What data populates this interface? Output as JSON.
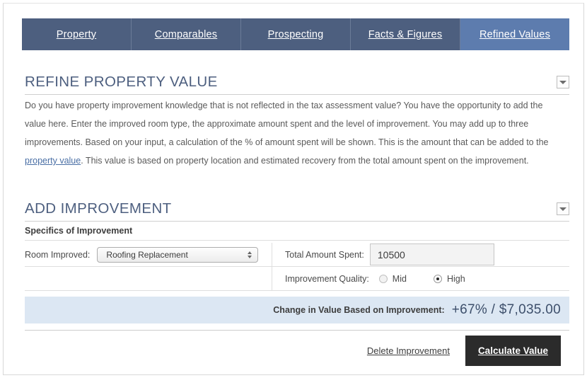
{
  "tabs": [
    {
      "label": "Property",
      "active": false
    },
    {
      "label": "Comparables",
      "active": false
    },
    {
      "label": "Prospecting",
      "active": false
    },
    {
      "label": "Facts & Figures",
      "active": false
    },
    {
      "label": "Refined Values",
      "active": true
    }
  ],
  "refine_section": {
    "title": "REFINE PROPERTY VALUE",
    "paragraph_part1": "Do you have property improvement knowledge that is not reflected in the tax assessment value? You have the opportunity to add the value here. Enter the improved room type, the approximate amount spent and the level of improvement. You may add up to three improvements. Based on your input, a calculation of the % of amount spent will be shown. This is the amount that can be added to the ",
    "link_text": "property value",
    "paragraph_part2": ". This value is based on property location and estimated recovery from the total amount spent on the improvement."
  },
  "improvement_section": {
    "title": "ADD IMPROVEMENT",
    "specifics_label": "Specifics of Improvement",
    "room_label": "Room Improved:",
    "room_value": "Roofing Replacement",
    "room_options": [
      "Roofing Replacement"
    ],
    "amount_label": "Total Amount Spent:",
    "amount_value": "10500",
    "amount_placeholder": "",
    "quality_label": "Improvement Quality:",
    "quality_options": [
      {
        "label": "Mid",
        "selected": false
      },
      {
        "label": "High",
        "selected": true
      }
    ]
  },
  "result": {
    "label": "Change in Value Based on Improvement:",
    "value": "+67% / $7,035.00"
  },
  "actions": {
    "delete_label": "Delete Improvement",
    "calculate_label": "Calculate Value"
  },
  "colors": {
    "tab_bar": "#4d5f7f",
    "tab_active": "#5d7cae",
    "heading": "#4d5f7f",
    "result_bar": "#dce7f3",
    "primary_button": "#2b2b2b",
    "link": "#4a6fa5"
  }
}
